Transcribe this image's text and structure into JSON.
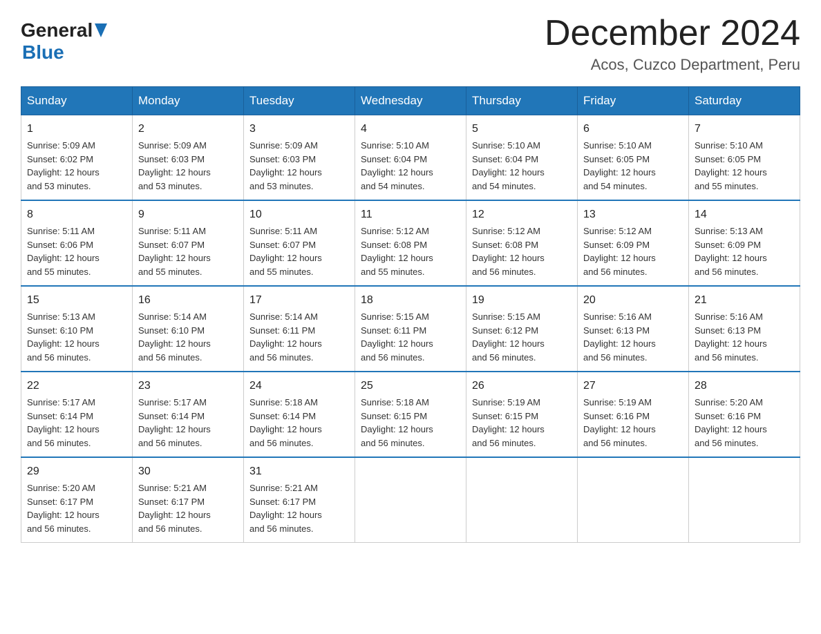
{
  "header": {
    "logo_general": "General",
    "logo_blue": "Blue",
    "month_title": "December 2024",
    "location": "Acos, Cuzco Department, Peru"
  },
  "days_of_week": [
    "Sunday",
    "Monday",
    "Tuesday",
    "Wednesday",
    "Thursday",
    "Friday",
    "Saturday"
  ],
  "weeks": [
    [
      {
        "day": "1",
        "sunrise": "5:09 AM",
        "sunset": "6:02 PM",
        "daylight": "12 hours and 53 minutes."
      },
      {
        "day": "2",
        "sunrise": "5:09 AM",
        "sunset": "6:03 PM",
        "daylight": "12 hours and 53 minutes."
      },
      {
        "day": "3",
        "sunrise": "5:09 AM",
        "sunset": "6:03 PM",
        "daylight": "12 hours and 53 minutes."
      },
      {
        "day": "4",
        "sunrise": "5:10 AM",
        "sunset": "6:04 PM",
        "daylight": "12 hours and 54 minutes."
      },
      {
        "day": "5",
        "sunrise": "5:10 AM",
        "sunset": "6:04 PM",
        "daylight": "12 hours and 54 minutes."
      },
      {
        "day": "6",
        "sunrise": "5:10 AM",
        "sunset": "6:05 PM",
        "daylight": "12 hours and 54 minutes."
      },
      {
        "day": "7",
        "sunrise": "5:10 AM",
        "sunset": "6:05 PM",
        "daylight": "12 hours and 55 minutes."
      }
    ],
    [
      {
        "day": "8",
        "sunrise": "5:11 AM",
        "sunset": "6:06 PM",
        "daylight": "12 hours and 55 minutes."
      },
      {
        "day": "9",
        "sunrise": "5:11 AM",
        "sunset": "6:07 PM",
        "daylight": "12 hours and 55 minutes."
      },
      {
        "day": "10",
        "sunrise": "5:11 AM",
        "sunset": "6:07 PM",
        "daylight": "12 hours and 55 minutes."
      },
      {
        "day": "11",
        "sunrise": "5:12 AM",
        "sunset": "6:08 PM",
        "daylight": "12 hours and 55 minutes."
      },
      {
        "day": "12",
        "sunrise": "5:12 AM",
        "sunset": "6:08 PM",
        "daylight": "12 hours and 56 minutes."
      },
      {
        "day": "13",
        "sunrise": "5:12 AM",
        "sunset": "6:09 PM",
        "daylight": "12 hours and 56 minutes."
      },
      {
        "day": "14",
        "sunrise": "5:13 AM",
        "sunset": "6:09 PM",
        "daylight": "12 hours and 56 minutes."
      }
    ],
    [
      {
        "day": "15",
        "sunrise": "5:13 AM",
        "sunset": "6:10 PM",
        "daylight": "12 hours and 56 minutes."
      },
      {
        "day": "16",
        "sunrise": "5:14 AM",
        "sunset": "6:10 PM",
        "daylight": "12 hours and 56 minutes."
      },
      {
        "day": "17",
        "sunrise": "5:14 AM",
        "sunset": "6:11 PM",
        "daylight": "12 hours and 56 minutes."
      },
      {
        "day": "18",
        "sunrise": "5:15 AM",
        "sunset": "6:11 PM",
        "daylight": "12 hours and 56 minutes."
      },
      {
        "day": "19",
        "sunrise": "5:15 AM",
        "sunset": "6:12 PM",
        "daylight": "12 hours and 56 minutes."
      },
      {
        "day": "20",
        "sunrise": "5:16 AM",
        "sunset": "6:13 PM",
        "daylight": "12 hours and 56 minutes."
      },
      {
        "day": "21",
        "sunrise": "5:16 AM",
        "sunset": "6:13 PM",
        "daylight": "12 hours and 56 minutes."
      }
    ],
    [
      {
        "day": "22",
        "sunrise": "5:17 AM",
        "sunset": "6:14 PM",
        "daylight": "12 hours and 56 minutes."
      },
      {
        "day": "23",
        "sunrise": "5:17 AM",
        "sunset": "6:14 PM",
        "daylight": "12 hours and 56 minutes."
      },
      {
        "day": "24",
        "sunrise": "5:18 AM",
        "sunset": "6:14 PM",
        "daylight": "12 hours and 56 minutes."
      },
      {
        "day": "25",
        "sunrise": "5:18 AM",
        "sunset": "6:15 PM",
        "daylight": "12 hours and 56 minutes."
      },
      {
        "day": "26",
        "sunrise": "5:19 AM",
        "sunset": "6:15 PM",
        "daylight": "12 hours and 56 minutes."
      },
      {
        "day": "27",
        "sunrise": "5:19 AM",
        "sunset": "6:16 PM",
        "daylight": "12 hours and 56 minutes."
      },
      {
        "day": "28",
        "sunrise": "5:20 AM",
        "sunset": "6:16 PM",
        "daylight": "12 hours and 56 minutes."
      }
    ],
    [
      {
        "day": "29",
        "sunrise": "5:20 AM",
        "sunset": "6:17 PM",
        "daylight": "12 hours and 56 minutes."
      },
      {
        "day": "30",
        "sunrise": "5:21 AM",
        "sunset": "6:17 PM",
        "daylight": "12 hours and 56 minutes."
      },
      {
        "day": "31",
        "sunrise": "5:21 AM",
        "sunset": "6:17 PM",
        "daylight": "12 hours and 56 minutes."
      },
      null,
      null,
      null,
      null
    ]
  ]
}
